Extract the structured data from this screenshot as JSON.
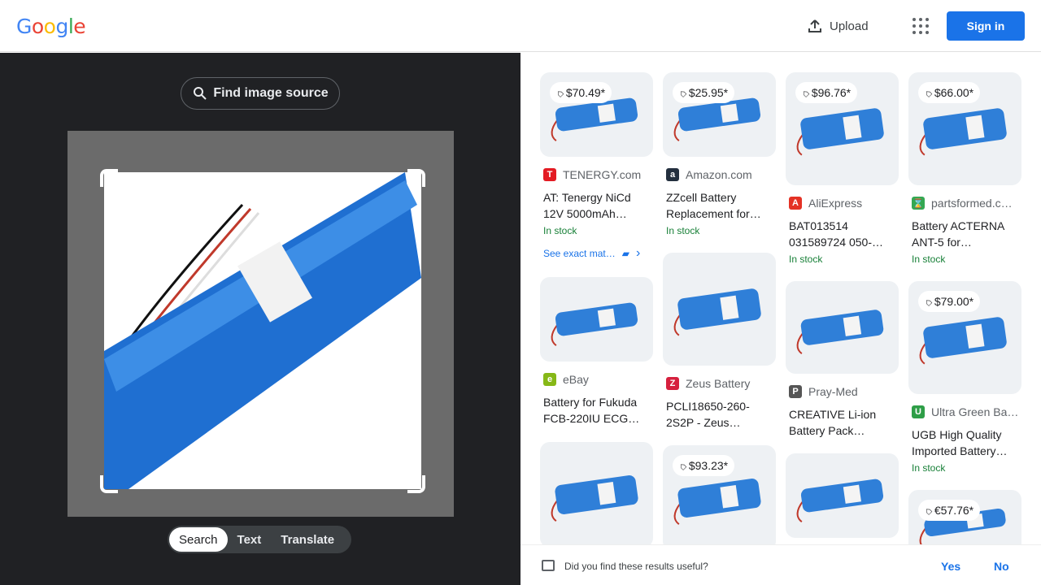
{
  "header": {
    "logo_letters": [
      {
        "ch": "G",
        "color": "#4285f4"
      },
      {
        "ch": "o",
        "color": "#ea4335"
      },
      {
        "ch": "o",
        "color": "#fbbc05"
      },
      {
        "ch": "g",
        "color": "#4285f4"
      },
      {
        "ch": "l",
        "color": "#34a853"
      },
      {
        "ch": "e",
        "color": "#ea4335"
      }
    ],
    "upload_label": "Upload",
    "signin_label": "Sign in",
    "accent": "#1a73e8"
  },
  "left": {
    "find_source_label": "Find image source",
    "tabs": [
      "Search",
      "Text",
      "Translate"
    ],
    "active_tab": "Search"
  },
  "results": [
    {
      "price": "$70.49*",
      "source": "TENERGY.com",
      "favicon": "T",
      "favicon_color": "#e31b23",
      "title": "AT: Tenergy NiCd 12V 5000mAh…",
      "stock": "In stock",
      "extra": "See exact mat…"
    },
    {
      "price": "$25.95*",
      "source": "Amazon.com",
      "favicon": "a",
      "favicon_color": "#232f3e",
      "title": "ZZcell Battery Replacement for…",
      "stock": "In stock"
    },
    {
      "price": "$96.76*",
      "source": "AliExpress",
      "favicon": "A",
      "favicon_color": "#e43225",
      "title": "BAT013514 031589724 050-…",
      "stock": "In stock"
    },
    {
      "price": "$66.00*",
      "source": "partsformed.c…",
      "favicon": "⌛",
      "favicon_color": "#34a853",
      "title": "Battery ACTERNA ANT-5 for…",
      "stock": "In stock"
    },
    {
      "source": "eBay",
      "favicon": "e",
      "favicon_color": "#86b817",
      "title": "Battery for Fukuda FCB-220IU ECG…"
    },
    {
      "source": "Zeus Battery",
      "favicon": "Z",
      "favicon_color": "#d6203e",
      "title": "PCLI18650-260-2S2P - Zeus…"
    },
    {
      "source": "Pray-Med",
      "favicon": "P",
      "favicon_color": "#555555",
      "title": "CREATIVE Li-ion Battery Pack…"
    },
    {
      "price": "$79.00*",
      "source": "Ultra Green Ba…",
      "favicon": "U",
      "favicon_color": "#2e9e47",
      "title": "UGB High Quality Imported Battery…",
      "stock": "In stock"
    },
    {
      "price": "$93.23*"
    },
    {
      "price": "€57.76*"
    }
  ],
  "feedback": {
    "question": "Did you find these results useful?",
    "yes": "Yes",
    "no": "No"
  }
}
